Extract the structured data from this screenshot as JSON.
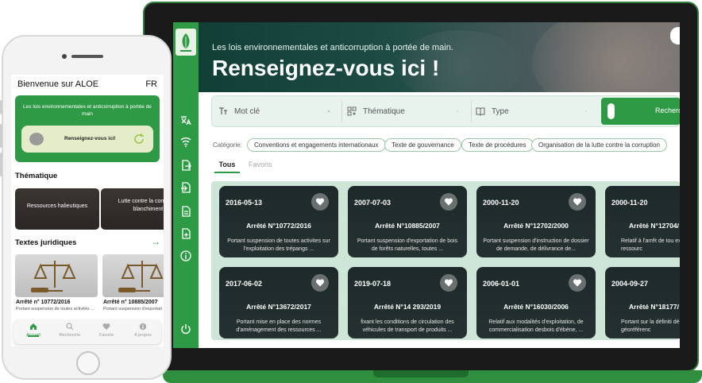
{
  "desktop": {
    "hero": {
      "subtitle": "Les lois environnementales et anticorruption à portée de main.",
      "title": "Renseignez-vous ici !"
    },
    "search": {
      "keyword_placeholder": "Mot clé",
      "theme_placeholder": "Thématique",
      "type_placeholder": "Type",
      "button_label": "Recherche"
    },
    "categories": {
      "label": "Catégorie:",
      "chips": [
        "Conventions et engagements internationaux",
        "Texte de gouvernance",
        "Texte de procédures",
        "Organisation de la lutte contre la corruption"
      ]
    },
    "tabs": {
      "all": "Tous",
      "favorites": "Favoris"
    },
    "cards": [
      {
        "date": "2016-05-13",
        "number": "Arrêté N°10772/2016",
        "description": "Portant suspension de toutes activites sur l'exploitation des trépangs ..."
      },
      {
        "date": "2007-07-03",
        "number": "Arrêté N°10885/2007",
        "description": "Portant suspension d'exportation de bois de forêts naturelles, toutes ..."
      },
      {
        "date": "2000-11-20",
        "number": "Arrêté N°12702/2000",
        "description": "Portant suspension d'instruction de dossier de demande, de délivrance de..."
      },
      {
        "date": "2000-11-20",
        "number": "Arrêté N°12704/",
        "description": "Relatif à l'arrêt de tou extractive de ressourc"
      },
      {
        "date": "2017-06-02",
        "number": "Arrêté N°13672/2017",
        "description": "Portant mise en place des normes d'aménagement des ressources ..."
      },
      {
        "date": "2019-07-18",
        "number": "Arrêté N°14 293/2019",
        "description": "fixant les conditions de circulation des véhicules de transport de produits ..."
      },
      {
        "date": "2006-01-01",
        "number": "Arrêté N°16030/2006",
        "description": "Relatif aux modalités d'exploitation, de commercialisation desbois d'ébène, ..."
      },
      {
        "date": "2004-09-27",
        "number": "Arrêté N°18177/",
        "description": "Portant sur la définiti délimitation géoréférenc"
      }
    ],
    "sidebar_icons": [
      "translate-icon",
      "wifi-icon",
      "document-export-icon",
      "document-import-icon",
      "file-icon",
      "file-add-icon",
      "info-icon",
      "power-icon"
    ]
  },
  "mobile": {
    "title": "Bienvenue sur ALOE",
    "lang": "FR",
    "banner_text": "Les lois environnementales et anticorruption à portée de main",
    "banner_button": "Renseignez-vous ici!",
    "themes_heading": "Thématique",
    "themes": [
      "Ressources halieutiques",
      "Lutte contre la corruption et le blanchiment d'arg"
    ],
    "texts_heading": "Textes juridiques",
    "texts": [
      {
        "number": "Arrêté n° 10772/2016",
        "description": "Portant suspension de toutes activités ..."
      },
      {
        "number": "Arrêté n° 10885/2007",
        "description": "Portant suspension d'exportati"
      }
    ],
    "nav": [
      "Accueil",
      "Recherche",
      "Favoris",
      "A propos"
    ]
  },
  "colors": {
    "brand_green": "#2f9a45",
    "card_dark": "#1e2a2a",
    "grid_bg": "#cde6d8"
  }
}
